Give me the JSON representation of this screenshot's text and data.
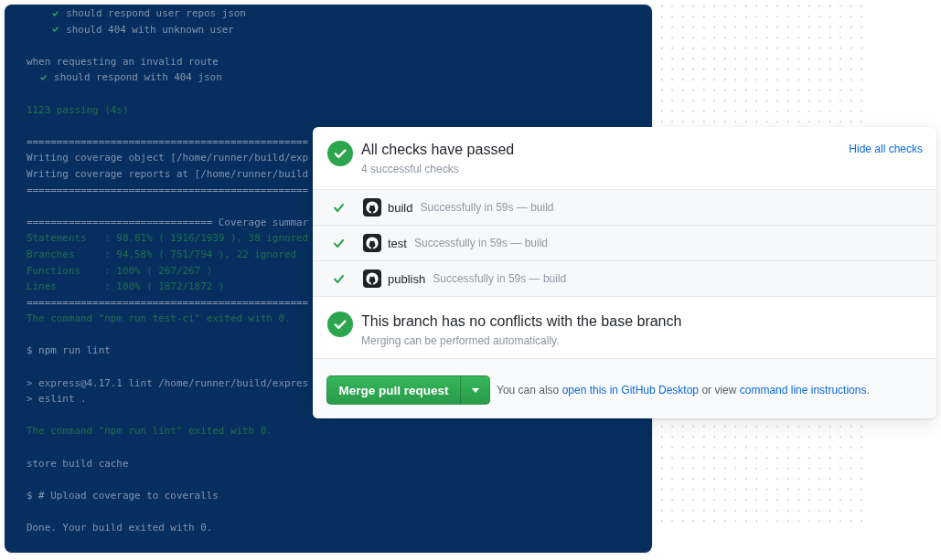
{
  "terminal": {
    "blocks": [
      {
        "lines": [
          {
            "kind": "suite",
            "children": [
              {
                "kind": "suite",
                "children": [
                  {
                    "kind": "test",
                    "text": "should respond user repos json",
                    "passed": true
                  },
                  {
                    "kind": "test",
                    "text": "should 404 with unknown user",
                    "passed": true
                  }
                ]
              }
            ]
          }
        ]
      },
      {
        "lines": [
          {
            "kind": "suite",
            "title": "when requesting an invalid route",
            "children": [
              {
                "kind": "test",
                "text": "should respond with 404 json",
                "passed": true
              }
            ]
          }
        ]
      },
      {
        "lines": [
          {
            "kind": "success",
            "text": "1123 passing (4s)"
          }
        ]
      },
      {
        "lines": [
          {
            "kind": "output",
            "text": "==============================================="
          },
          {
            "kind": "output",
            "text": "Writing coverage object [/home/runner/build/exp"
          },
          {
            "kind": "output",
            "text": "Writing coverage reports at [/home/runner/build"
          },
          {
            "kind": "output",
            "text": "==============================================="
          }
        ]
      },
      {
        "lines": [
          {
            "kind": "output",
            "text": "=============================== Coverage summar"
          },
          {
            "kind": "success",
            "text": "Statements   : 98.81% ( 1916/1939 ), 38 ignored"
          },
          {
            "kind": "success",
            "text": "Branches     : 94.58% ( 751/794 ), 22 ignored"
          },
          {
            "kind": "success",
            "text": "Functions    : 100% ( 267/267 )"
          },
          {
            "kind": "success",
            "text": "Lines        : 100% ( 1872/1872 )"
          },
          {
            "kind": "output",
            "text": "==============================================="
          },
          {
            "kind": "success",
            "text": "The command \"npm run test-ci\" exited with 0."
          }
        ]
      },
      {
        "lines": [
          {
            "kind": "output",
            "text": "$ npm run lint"
          }
        ]
      },
      {
        "lines": [
          {
            "kind": "output",
            "text": "> express@4.17.1 lint /home/runner/build/expres"
          },
          {
            "kind": "output",
            "text": "> eslint ."
          }
        ]
      },
      {
        "lines": [
          {
            "kind": "success",
            "text": "The command \"npm run lint\" exited with 0."
          }
        ]
      },
      {
        "lines": [
          {
            "kind": "output",
            "text": "store build cache"
          }
        ]
      },
      {
        "lines": [
          {
            "kind": "output",
            "text": "$ # Upload coverage to coveralls"
          }
        ]
      },
      {
        "lines": [
          {
            "kind": "output",
            "text": "Done. Your build exited with 0."
          }
        ]
      }
    ]
  },
  "checks": {
    "passed": true,
    "title": "All checks have passed",
    "subtitle": "4 successful checks",
    "toggle": "Hide all checks",
    "items": [
      {
        "name": "build",
        "detail": "Successfully in 59s — build",
        "passed": true
      },
      {
        "name": "test",
        "detail": "Successfully in 59s — build",
        "passed": true
      },
      {
        "name": "publish",
        "detail": "Successfully in 59s — build",
        "passed": true
      }
    ]
  },
  "merge": {
    "passed": true,
    "title": "This branch has no conflicts with the base branch",
    "subtitle": "Merging can be performed automatically.",
    "button": "Merge pull request",
    "help": [
      {
        "kind": "text",
        "text": "You can also "
      },
      {
        "kind": "link",
        "text": "open this in GitHub Desktop"
      },
      {
        "kind": "text",
        "text": " or view "
      },
      {
        "kind": "link",
        "text": "command line instructions"
      },
      {
        "kind": "text",
        "text": "."
      }
    ]
  }
}
